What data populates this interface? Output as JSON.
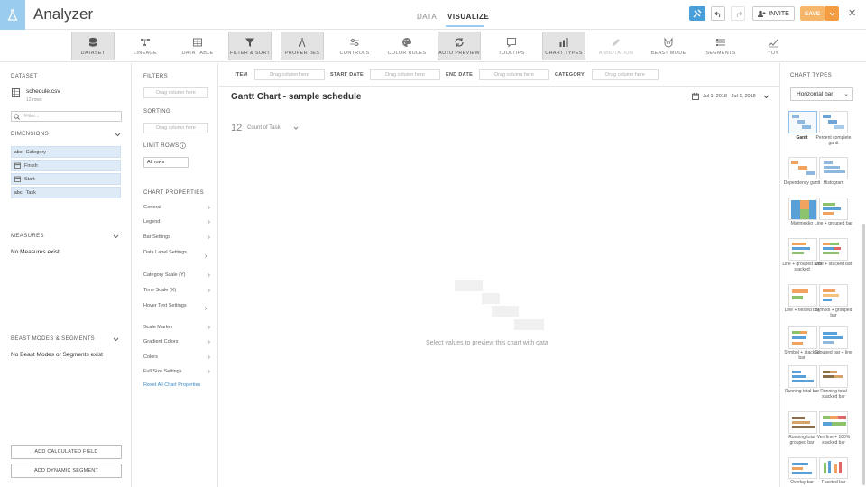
{
  "app": {
    "title": "Analyzer"
  },
  "modes": [
    {
      "label": "DATA"
    },
    {
      "label": "VISUALIZE"
    }
  ],
  "header": {
    "invite_label": "INVITE",
    "save_label": "SAVE"
  },
  "toolbar": [
    {
      "label": "DATASET",
      "icon": "database-icon"
    },
    {
      "label": "LINEAGE",
      "icon": "lineage-icon"
    },
    {
      "label": "DATA TABLE",
      "icon": "table-icon"
    },
    {
      "label": "FILTER & SORT",
      "icon": "filter-icon"
    },
    {
      "label": "PROPERTIES",
      "icon": "properties-icon"
    },
    {
      "label": "CONTROLS",
      "icon": "controls-icon"
    },
    {
      "label": "COLOR RULES",
      "icon": "palette-icon"
    },
    {
      "label": "AUTO PREVIEW",
      "icon": "refresh-icon"
    },
    {
      "label": "TOOLTIPS",
      "icon": "tooltip-icon"
    },
    {
      "label": "CHART TYPES",
      "icon": "bar-chart-icon"
    },
    {
      "label": "ANNOTATION",
      "icon": "pencil-icon"
    },
    {
      "label": "BEAST MODE",
      "icon": "beast-icon"
    },
    {
      "label": "SEGMENTS",
      "icon": "segments-icon"
    },
    {
      "label": "YOY",
      "icon": "yoy-icon"
    }
  ],
  "left": {
    "dataset_title": "DATASET",
    "file_name": "schedule.csv",
    "file_rows": "12 rows",
    "filter_placeholder": "Filter...",
    "dimensions_title": "DIMENSIONS",
    "dimensions": [
      {
        "type": "abc",
        "label": "Category"
      },
      {
        "type": "date",
        "label": "Finish"
      },
      {
        "type": "date",
        "label": "Start"
      },
      {
        "type": "abc",
        "label": "Task"
      }
    ],
    "measures_title": "MEASURES",
    "measures_empty": "No Measures exist",
    "beast_title": "BEAST MODES & SEGMENTS",
    "beast_empty": "No Beast Modes or Segments exist",
    "add_calc": "ADD CALCULATED FIELD",
    "add_segment": "ADD DYNAMIC SEGMENT"
  },
  "mid": {
    "filters_title": "FILTERS",
    "drag_here": "Drag column here",
    "sorting_title": "SORTING",
    "limit_title": "LIMIT ROWS",
    "limit_value": "All rows",
    "chart_props_title": "CHART PROPERTIES",
    "props": [
      "General",
      "Legend",
      "Bar Settings",
      "Data Label Settings",
      "Category Scale (Y)",
      "Time Scale (X)",
      "Hover Text Settings",
      "Scale Marker",
      "Gradient Colors",
      "Colors",
      "Full Size Settings"
    ],
    "reset": "Reset All Chart Properties"
  },
  "axes": {
    "item": "ITEM",
    "start": "START DATE",
    "end": "END DATE",
    "category": "CATEGORY",
    "drag_here": "Drag column here"
  },
  "center": {
    "chart_title": "Gantt Chart - sample schedule",
    "date_range": "Jul 1, 2018 - Jul 1, 2018",
    "summary_number": "12",
    "summary_label": "Count of Task",
    "empty_message": "Select values to preview this chart with data"
  },
  "right": {
    "title": "CHART TYPES",
    "selected": "Horizontal bar",
    "types": [
      "Gantt",
      "Percent complete gantt",
      "Dependency gantt",
      "Histogram",
      "Marimekko",
      "Line + grouped bar",
      "Line + grouped and stacked",
      "Line + stacked bar",
      "Line + nested bar",
      "Symbol + grouped bar",
      "Symbol + stacked bar",
      "Grouped bar + line",
      "Running total bar",
      "Running total stacked bar",
      "Running total grouped bar",
      "Vert line + 100% stacked bar",
      "Overlay bar",
      "Faceted bar"
    ]
  },
  "colors": {
    "accent": "#99ccee",
    "save": "#f6b66a",
    "link": "#3b87c8",
    "dimension_bg": "#deebf7"
  }
}
